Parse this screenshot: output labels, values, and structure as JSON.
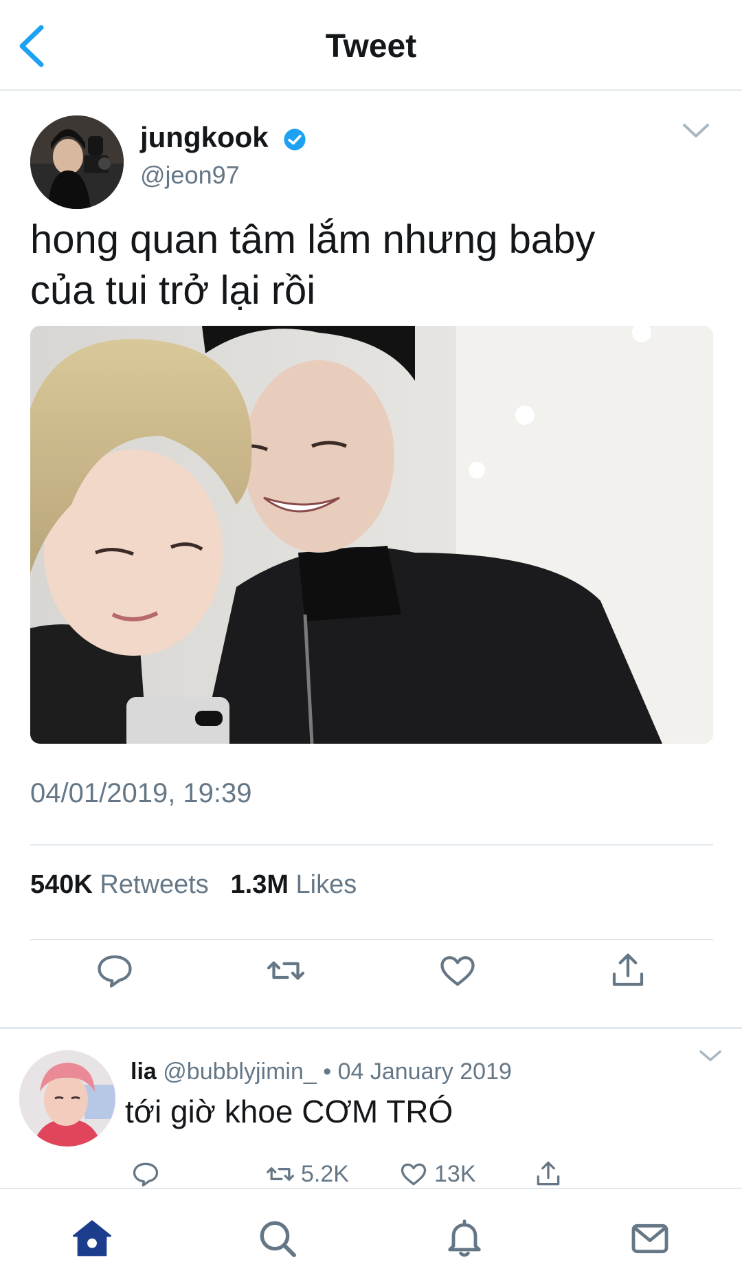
{
  "header": {
    "title": "Tweet",
    "back_icon": "chevron-left-icon"
  },
  "tweet": {
    "author_name": "jungkook",
    "verified_icon": "verified-badge-icon",
    "handle": "@jeon97",
    "text_line1": "hong quan tâm lắm nhưng baby",
    "text_line2": "của tui trở lại rồi",
    "timestamp": "04/01/2019, 19:39",
    "retweets_count": "540K",
    "retweets_label": "Retweets",
    "likes_count": "1.3M",
    "likes_label": "Likes",
    "actions": [
      "reply-icon",
      "retweet-icon",
      "like-icon",
      "share-icon"
    ]
  },
  "reply": {
    "name": "lia",
    "handle": "@bubblyjimin_",
    "separator": "•",
    "date": "04 January 2019",
    "text": "tới giờ khoe CƠM TRÓ",
    "retweets": "5.2K",
    "likes": "13K"
  },
  "tabbar": {
    "items": [
      "home-icon",
      "search-icon",
      "notifications-icon",
      "messages-icon"
    ]
  },
  "colors": {
    "accent": "#1da1f2",
    "text": "#14171a",
    "muted": "#657786",
    "divider": "#e1e8ed",
    "home_active": "#1c3c8c"
  }
}
